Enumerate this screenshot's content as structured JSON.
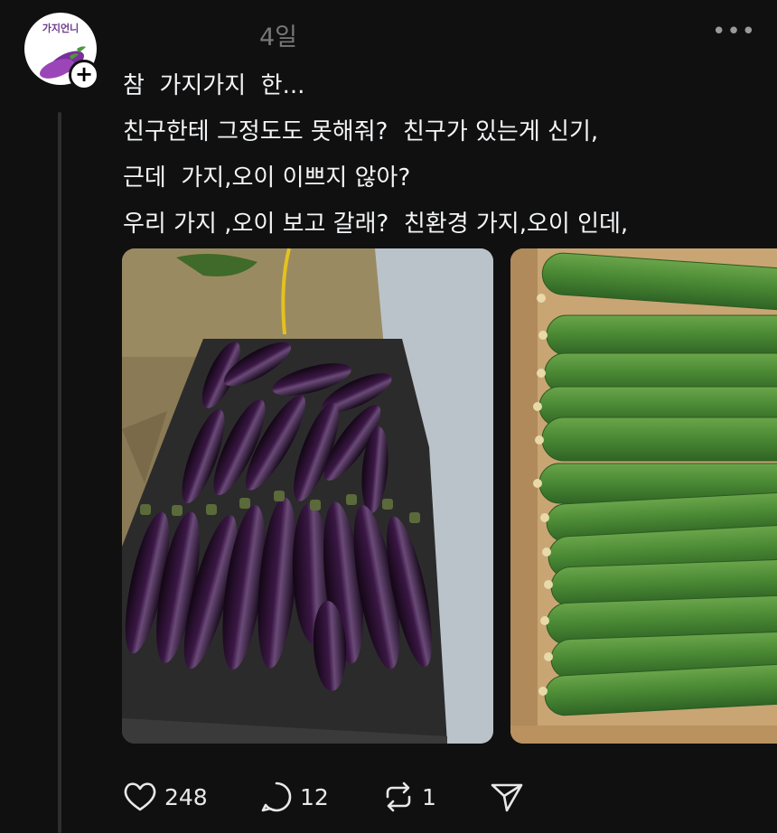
{
  "post": {
    "avatar_label": "가지언니",
    "username": "",
    "timestamp": "4일",
    "more_label": "•••",
    "follow_label": "+",
    "lines": [
      "참  가지가지  한...",
      "친구한테 그정도도 못해줘?  친구가 있는게 신기,",
      "근데  가지,오이 이쁘지 않아?",
      "우리 가지 ,오이 보고 갈래?  친환경 가지,오이 인데,"
    ],
    "images": [
      {
        "name": "eggplant-photo",
        "subject": "eggplants in a tarp"
      },
      {
        "name": "cucumber-photo",
        "subject": "cucumbers in a box"
      }
    ]
  },
  "actions": {
    "likes": "248",
    "replies": "12",
    "reposts": "1"
  },
  "colors": {
    "background": "#101010",
    "text": "#f3f5f7",
    "muted": "#777777",
    "eggplant": "#2a1030",
    "cucumber": "#4f8a3a"
  }
}
